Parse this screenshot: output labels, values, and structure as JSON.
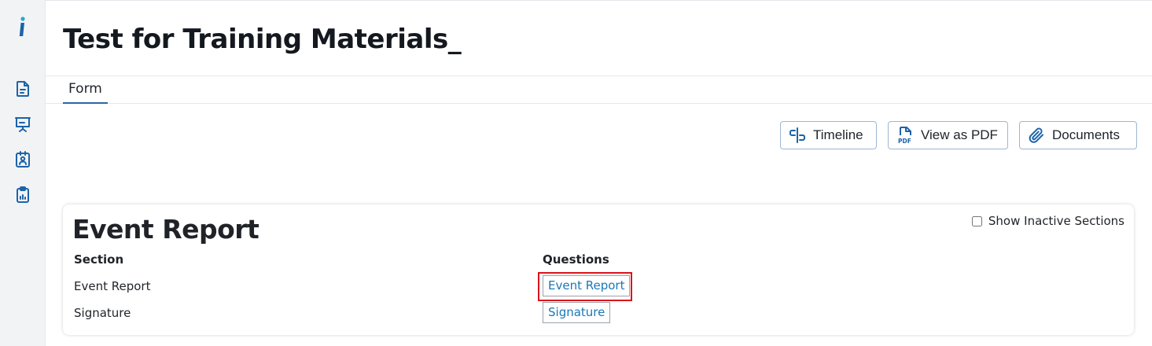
{
  "sidebar": {
    "logo_icon": "brand-i-icon",
    "items": [
      {
        "icon": "document-icon"
      },
      {
        "icon": "presentation-icon"
      },
      {
        "icon": "id-card-icon"
      },
      {
        "icon": "clipboard-chart-icon"
      }
    ]
  },
  "page": {
    "title": "Test for Training Materials_"
  },
  "tabs": [
    {
      "label": "Form",
      "active": true
    }
  ],
  "toolbar": {
    "timeline_label": "Timeline",
    "view_pdf_label": "View as PDF",
    "documents_label": "Documents"
  },
  "card": {
    "title": "Event Report",
    "show_inactive_label": "Show Inactive Sections",
    "show_inactive_checked": false,
    "columns": {
      "section": "Section",
      "questions": "Questions"
    },
    "rows": [
      {
        "section": "Event Report",
        "question": "Event Report"
      },
      {
        "section": "Signature",
        "question": "Signature"
      }
    ]
  },
  "colors": {
    "accent": "#1c63a8",
    "link": "#1878b8",
    "highlight": "#d9141b"
  }
}
